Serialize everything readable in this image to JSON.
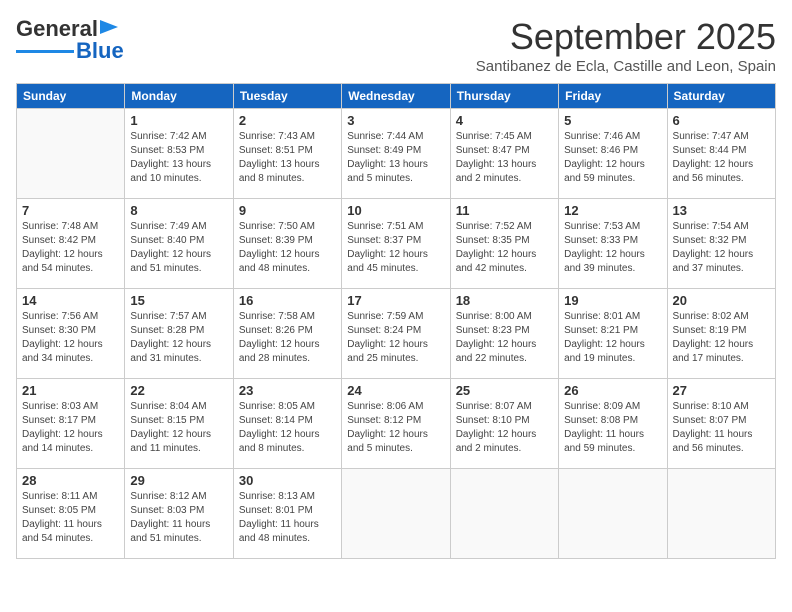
{
  "logo": {
    "line1": "General",
    "line2": "Blue"
  },
  "header": {
    "month": "September 2025",
    "location": "Santibanez de Ecla, Castille and Leon, Spain"
  },
  "weekdays": [
    "Sunday",
    "Monday",
    "Tuesday",
    "Wednesday",
    "Thursday",
    "Friday",
    "Saturday"
  ],
  "weeks": [
    [
      {
        "day": "",
        "info": ""
      },
      {
        "day": "1",
        "info": "Sunrise: 7:42 AM\nSunset: 8:53 PM\nDaylight: 13 hours\nand 10 minutes."
      },
      {
        "day": "2",
        "info": "Sunrise: 7:43 AM\nSunset: 8:51 PM\nDaylight: 13 hours\nand 8 minutes."
      },
      {
        "day": "3",
        "info": "Sunrise: 7:44 AM\nSunset: 8:49 PM\nDaylight: 13 hours\nand 5 minutes."
      },
      {
        "day": "4",
        "info": "Sunrise: 7:45 AM\nSunset: 8:47 PM\nDaylight: 13 hours\nand 2 minutes."
      },
      {
        "day": "5",
        "info": "Sunrise: 7:46 AM\nSunset: 8:46 PM\nDaylight: 12 hours\nand 59 minutes."
      },
      {
        "day": "6",
        "info": "Sunrise: 7:47 AM\nSunset: 8:44 PM\nDaylight: 12 hours\nand 56 minutes."
      }
    ],
    [
      {
        "day": "7",
        "info": "Sunrise: 7:48 AM\nSunset: 8:42 PM\nDaylight: 12 hours\nand 54 minutes."
      },
      {
        "day": "8",
        "info": "Sunrise: 7:49 AM\nSunset: 8:40 PM\nDaylight: 12 hours\nand 51 minutes."
      },
      {
        "day": "9",
        "info": "Sunrise: 7:50 AM\nSunset: 8:39 PM\nDaylight: 12 hours\nand 48 minutes."
      },
      {
        "day": "10",
        "info": "Sunrise: 7:51 AM\nSunset: 8:37 PM\nDaylight: 12 hours\nand 45 minutes."
      },
      {
        "day": "11",
        "info": "Sunrise: 7:52 AM\nSunset: 8:35 PM\nDaylight: 12 hours\nand 42 minutes."
      },
      {
        "day": "12",
        "info": "Sunrise: 7:53 AM\nSunset: 8:33 PM\nDaylight: 12 hours\nand 39 minutes."
      },
      {
        "day": "13",
        "info": "Sunrise: 7:54 AM\nSunset: 8:32 PM\nDaylight: 12 hours\nand 37 minutes."
      }
    ],
    [
      {
        "day": "14",
        "info": "Sunrise: 7:56 AM\nSunset: 8:30 PM\nDaylight: 12 hours\nand 34 minutes."
      },
      {
        "day": "15",
        "info": "Sunrise: 7:57 AM\nSunset: 8:28 PM\nDaylight: 12 hours\nand 31 minutes."
      },
      {
        "day": "16",
        "info": "Sunrise: 7:58 AM\nSunset: 8:26 PM\nDaylight: 12 hours\nand 28 minutes."
      },
      {
        "day": "17",
        "info": "Sunrise: 7:59 AM\nSunset: 8:24 PM\nDaylight: 12 hours\nand 25 minutes."
      },
      {
        "day": "18",
        "info": "Sunrise: 8:00 AM\nSunset: 8:23 PM\nDaylight: 12 hours\nand 22 minutes."
      },
      {
        "day": "19",
        "info": "Sunrise: 8:01 AM\nSunset: 8:21 PM\nDaylight: 12 hours\nand 19 minutes."
      },
      {
        "day": "20",
        "info": "Sunrise: 8:02 AM\nSunset: 8:19 PM\nDaylight: 12 hours\nand 17 minutes."
      }
    ],
    [
      {
        "day": "21",
        "info": "Sunrise: 8:03 AM\nSunset: 8:17 PM\nDaylight: 12 hours\nand 14 minutes."
      },
      {
        "day": "22",
        "info": "Sunrise: 8:04 AM\nSunset: 8:15 PM\nDaylight: 12 hours\nand 11 minutes."
      },
      {
        "day": "23",
        "info": "Sunrise: 8:05 AM\nSunset: 8:14 PM\nDaylight: 12 hours\nand 8 minutes."
      },
      {
        "day": "24",
        "info": "Sunrise: 8:06 AM\nSunset: 8:12 PM\nDaylight: 12 hours\nand 5 minutes."
      },
      {
        "day": "25",
        "info": "Sunrise: 8:07 AM\nSunset: 8:10 PM\nDaylight: 12 hours\nand 2 minutes."
      },
      {
        "day": "26",
        "info": "Sunrise: 8:09 AM\nSunset: 8:08 PM\nDaylight: 11 hours\nand 59 minutes."
      },
      {
        "day": "27",
        "info": "Sunrise: 8:10 AM\nSunset: 8:07 PM\nDaylight: 11 hours\nand 56 minutes."
      }
    ],
    [
      {
        "day": "28",
        "info": "Sunrise: 8:11 AM\nSunset: 8:05 PM\nDaylight: 11 hours\nand 54 minutes."
      },
      {
        "day": "29",
        "info": "Sunrise: 8:12 AM\nSunset: 8:03 PM\nDaylight: 11 hours\nand 51 minutes."
      },
      {
        "day": "30",
        "info": "Sunrise: 8:13 AM\nSunset: 8:01 PM\nDaylight: 11 hours\nand 48 minutes."
      },
      {
        "day": "",
        "info": ""
      },
      {
        "day": "",
        "info": ""
      },
      {
        "day": "",
        "info": ""
      },
      {
        "day": "",
        "info": ""
      }
    ]
  ]
}
